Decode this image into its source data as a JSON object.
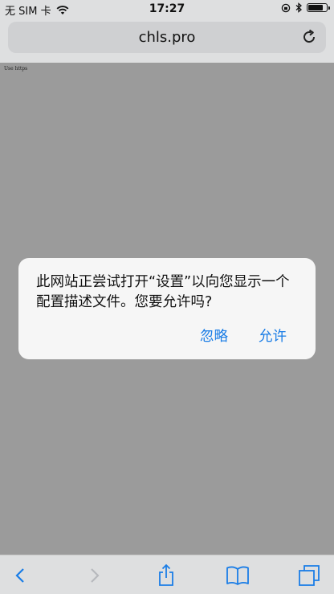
{
  "status_bar": {
    "carrier": "无 SIM 卡",
    "time": "17:27",
    "battery_level": 0.9
  },
  "url_bar": {
    "url": "chls.pro"
  },
  "page": {
    "body_text": "Use https"
  },
  "alert": {
    "message": "此网站正尝试打开“设置”以向您显示一个配置描述文件。您要允许吗?",
    "ignore_label": "忽略",
    "allow_label": "允许"
  },
  "toolbar": {
    "items": [
      "back-icon",
      "forward-icon",
      "share-icon",
      "bookmarks-icon",
      "tabs-icon"
    ]
  },
  "colors": {
    "accent": "#1a7de6",
    "overlay": "#9b9b9b",
    "chrome": "#dedfe0"
  }
}
